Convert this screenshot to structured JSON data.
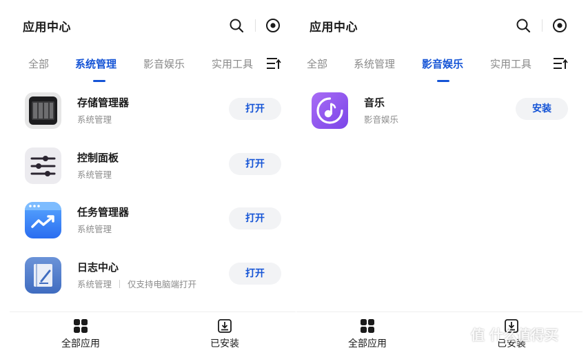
{
  "left": {
    "header": {
      "title": "应用中心"
    },
    "tabs": [
      "全部",
      "系统管理",
      "影音娱乐",
      "实用工具"
    ],
    "active_tab": 1,
    "apps": [
      {
        "name": "存储管理器",
        "category": "系统管理",
        "note": "",
        "action": "打开",
        "icon": "storage-manager-icon"
      },
      {
        "name": "控制面板",
        "category": "系统管理",
        "note": "",
        "action": "打开",
        "icon": "control-panel-icon"
      },
      {
        "name": "任务管理器",
        "category": "系统管理",
        "note": "",
        "action": "打开",
        "icon": "task-manager-icon"
      },
      {
        "name": "日志中心",
        "category": "系统管理",
        "note": "仅支持电脑端打开",
        "action": "打开",
        "icon": "log-center-icon"
      }
    ],
    "nav": [
      {
        "label": "全部应用",
        "icon": "grid-icon"
      },
      {
        "label": "已安装",
        "icon": "download-box-icon"
      }
    ]
  },
  "right": {
    "header": {
      "title": "应用中心"
    },
    "tabs": [
      "全部",
      "系统管理",
      "影音娱乐",
      "实用工具"
    ],
    "active_tab": 2,
    "apps": [
      {
        "name": "音乐",
        "category": "影音娱乐",
        "note": "",
        "action": "安装",
        "icon": "music-icon"
      }
    ],
    "nav": [
      {
        "label": "全部应用",
        "icon": "grid-icon"
      },
      {
        "label": "已安装",
        "icon": "download-box-icon"
      }
    ]
  },
  "colors": {
    "accent": "#1554d6",
    "button_bg": "#f2f3f5",
    "muted_text": "#8c8c8c"
  },
  "watermark": {
    "text": "值 什么值得买"
  }
}
